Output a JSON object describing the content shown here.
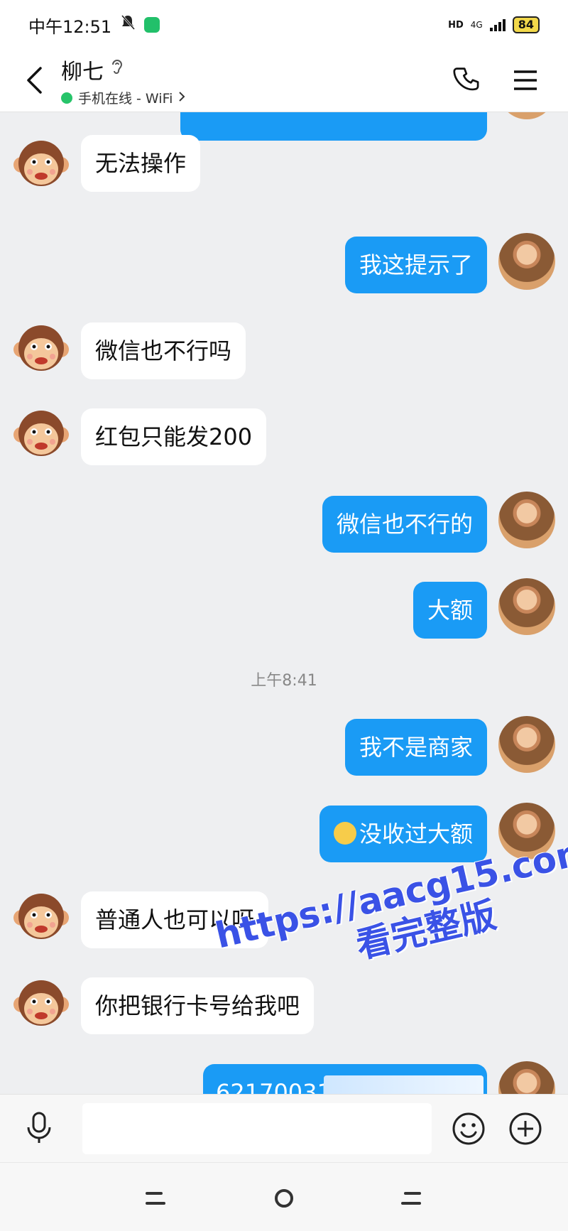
{
  "status_bar": {
    "time": "中午12:51",
    "network": "4G",
    "battery": "84"
  },
  "header": {
    "contact_name": "柳七",
    "status": "手机在线 - WiFi"
  },
  "messages": [
    {
      "side": "in",
      "text": "无法操作"
    },
    {
      "side": "out",
      "text": "我这提示了"
    },
    {
      "side": "in",
      "text": "微信也不行吗"
    },
    {
      "side": "in",
      "text": "红包只能发200"
    },
    {
      "side": "out",
      "text": "微信也不行的"
    },
    {
      "side": "out",
      "text": "大额"
    },
    {
      "side": "out",
      "text": "我不是商家"
    },
    {
      "side": "out",
      "text": "没收过大额"
    },
    {
      "side": "in",
      "text": "普通人也可以呀"
    },
    {
      "side": "in",
      "text": "你把银行卡号给我吧"
    },
    {
      "side": "out",
      "text": "62170031"
    }
  ],
  "timestamp": "上午8:41",
  "watermark": {
    "line1": "https://aacg15.com",
    "line2": "看完整版"
  },
  "input": {
    "placeholder": ""
  },
  "icons": {
    "back": "back-arrow-icon",
    "ear": "ear-icon",
    "call": "phone-icon",
    "menu": "menu-icon",
    "mic": "microphone-icon",
    "emoji": "emoji-icon",
    "plus": "plus-icon"
  },
  "colors": {
    "outgoing_bubble": "#1a9bf5",
    "incoming_bubble": "#ffffff",
    "online_dot": "#27c46a",
    "background": "#eeeff1"
  }
}
